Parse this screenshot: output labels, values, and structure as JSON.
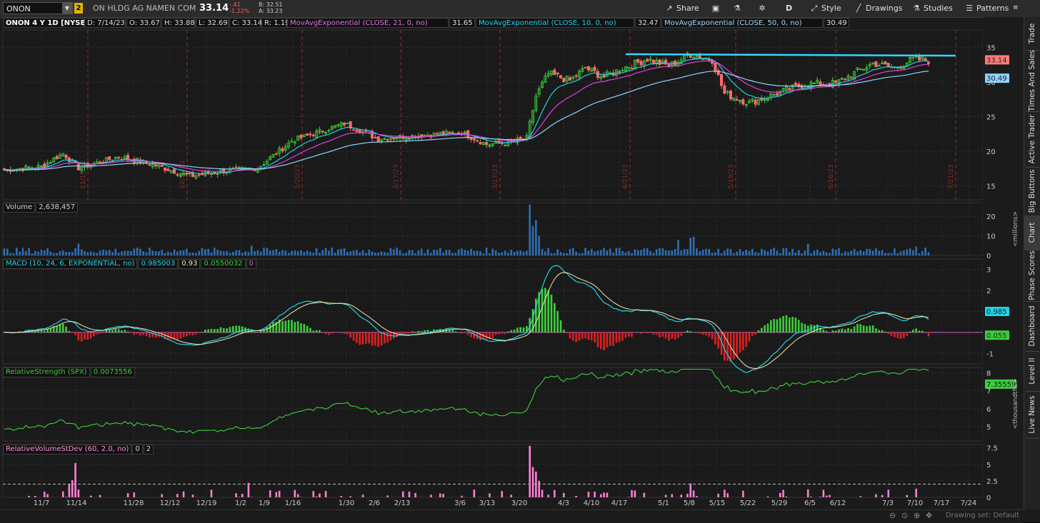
{
  "toolbar": {
    "symbol": "ONON",
    "link_badge": "2",
    "description": "ON HLDG AG NAMEN COM",
    "last": "33.14",
    "change": "-.41",
    "change_pct": "-1.22%",
    "bid": "B: 32.51",
    "ask": "A: 33.23",
    "buttons": {
      "share": "Share",
      "aggregation": "D",
      "style": "Style",
      "drawings": "Drawings",
      "studies": "Studies",
      "patterns": "Patterns"
    }
  },
  "chart_header": {
    "title": "ONON 4 Y 1D [NYSE]",
    "date": "D: 7/14/23",
    "open": "O: 33.67",
    "high": "H: 33.88",
    "low": "L: 32.69",
    "close": "C: 33.14",
    "range": "R: 1.19",
    "ema21_label": "MovAvgExponential (CLOSE, 21, 0, no)",
    "ema21_value": "31.65",
    "ema10_label": "MovAvgExponential (CLOSE, 10, 0, no)",
    "ema10_value": "32.47",
    "ema50_label": "MovAvgExponential (CLOSE, 50, 0, no)",
    "ema50_value": "30.49"
  },
  "price_panel": {
    "y_ticks": [
      "35",
      "30",
      "25",
      "20",
      "15"
    ],
    "last_label": "33.14",
    "ema50_label": "30.49",
    "earnings_dates": [
      "11/15/22",
      "12/16/22",
      "1/20/23",
      "2/17/23",
      "3/17/23",
      "4/21/23",
      "5/19/23",
      "6/16/23",
      "7/21/23"
    ],
    "colors": {
      "up": "#3cd03c",
      "down": "#ff6b6b",
      "ema10": "#22d3e6",
      "ema21": "#e040e0",
      "ema50": "#8fd3ff",
      "resistance": "#33d7ff"
    }
  },
  "volume_panel": {
    "label": "Volume",
    "value": "2,638,457",
    "y_ticks": [
      "20",
      "10",
      "0"
    ],
    "unit": "<millions>",
    "color": "#2f6fb5"
  },
  "macd_panel": {
    "label": "MACD (10, 24, 6, EXPONENTIAL, no)",
    "value": "0.985003",
    "avg": "0.93",
    "diff": "0.0550032",
    "zero": "0",
    "y_ticks": [
      "3",
      "2",
      "1",
      "0",
      "-1"
    ],
    "last_label": "0.985",
    "diff_label": "0.055"
  },
  "rs_panel": {
    "label": "RelativeStrength (SPX)",
    "value": "0.0073556",
    "y_ticks": [
      "8",
      "7",
      "6",
      "5"
    ],
    "last_label": "7.35559",
    "unit": "<thousandths>"
  },
  "rvol_panel": {
    "label": "RelativeVolumeStDev (60, 2.0, no)",
    "value1": "0",
    "value2": "2",
    "y_ticks": [
      "7.5",
      "5",
      "2.5",
      "0"
    ]
  },
  "x_axis": {
    "labels": [
      "11/7",
      "11/14",
      "11/28",
      "12/12",
      "12/19",
      "1/2",
      "1/9",
      "1/16",
      "1/30",
      "2/6",
      "2/13",
      "3/6",
      "3/13",
      "3/20",
      "4/3",
      "4/10",
      "4/17",
      "5/1",
      "5/8",
      "5/15",
      "5/22",
      "5/29",
      "6/5",
      "6/12",
      "7/3",
      "7/10",
      "7/17",
      "7/24"
    ]
  },
  "sidebar": {
    "tabs": [
      "Trade",
      "Times And Sales",
      "Active Trader",
      "Big Buttons",
      "Chart",
      "Phase Scores",
      "Dashboard",
      "Level II",
      "Live News"
    ]
  },
  "footer": {
    "drawing_set": "Drawing set: Default"
  }
}
